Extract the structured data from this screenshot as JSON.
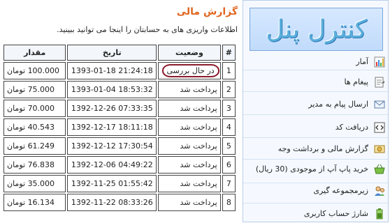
{
  "page": {
    "title": "گزارش مالی",
    "subtitle": "اطلاعات واریزی های به حسابتان را اینجا می توانید ببینید."
  },
  "table": {
    "headers": [
      "#",
      "وضعیت",
      "تاریخ",
      "مقدار"
    ],
    "rows": [
      {
        "num": "1",
        "status": "در حال بررسی",
        "date": "1393-01-18 21:24:18",
        "amount": "100.000 تومان"
      },
      {
        "num": "2",
        "status": "پرداخت شد",
        "date": "1393-01-04 18:53:32",
        "amount": "75.000 تومان"
      },
      {
        "num": "3",
        "status": "پرداخت شد",
        "date": "1392-12-26 07:33:35",
        "amount": "70.000 تومان"
      },
      {
        "num": "4",
        "status": "پرداخت شد",
        "date": "1392-12-17 18:11:18",
        "amount": "40.543 تومان"
      },
      {
        "num": "5",
        "status": "پرداخت شد",
        "date": "1392-12-12 17:30:54",
        "amount": "61.249 تومان"
      },
      {
        "num": "6",
        "status": "پرداخت شد",
        "date": "1392-12-06 04:49:22",
        "amount": "76.838 تومان"
      },
      {
        "num": "7",
        "status": "پرداخت شد",
        "date": "1392-11-25 01:55:42",
        "amount": "35.000 تومان"
      },
      {
        "num": "8",
        "status": "پرداخت شد",
        "date": "1392-11-22 08:33:26",
        "amount": "16.134 تومان"
      }
    ]
  },
  "sidebar": {
    "banner": "کنترل پنل",
    "items": [
      {
        "label": "آمار",
        "icon": "bar-chart-icon"
      },
      {
        "label": "پیغام ها",
        "icon": "message-icon"
      },
      {
        "label": "ارسال پیام به مدیر",
        "icon": "envelope-icon"
      },
      {
        "label": "دریافت کد",
        "icon": "code-icon"
      },
      {
        "label": "گزارش مالی و برداشت وجه",
        "icon": "money-icon"
      },
      {
        "label": "خرید پاپ آپ از موجودی (30 ریال)",
        "icon": "basket-icon"
      },
      {
        "label": "زیرمجموعه گیری",
        "icon": "users-icon"
      },
      {
        "label": "شارژ حساب کاربری",
        "icon": "charge-icon"
      }
    ]
  },
  "colors": {
    "title": "#e0651f",
    "banner_text": "#5aaedb",
    "highlight_circle": "#8a1a2a"
  }
}
